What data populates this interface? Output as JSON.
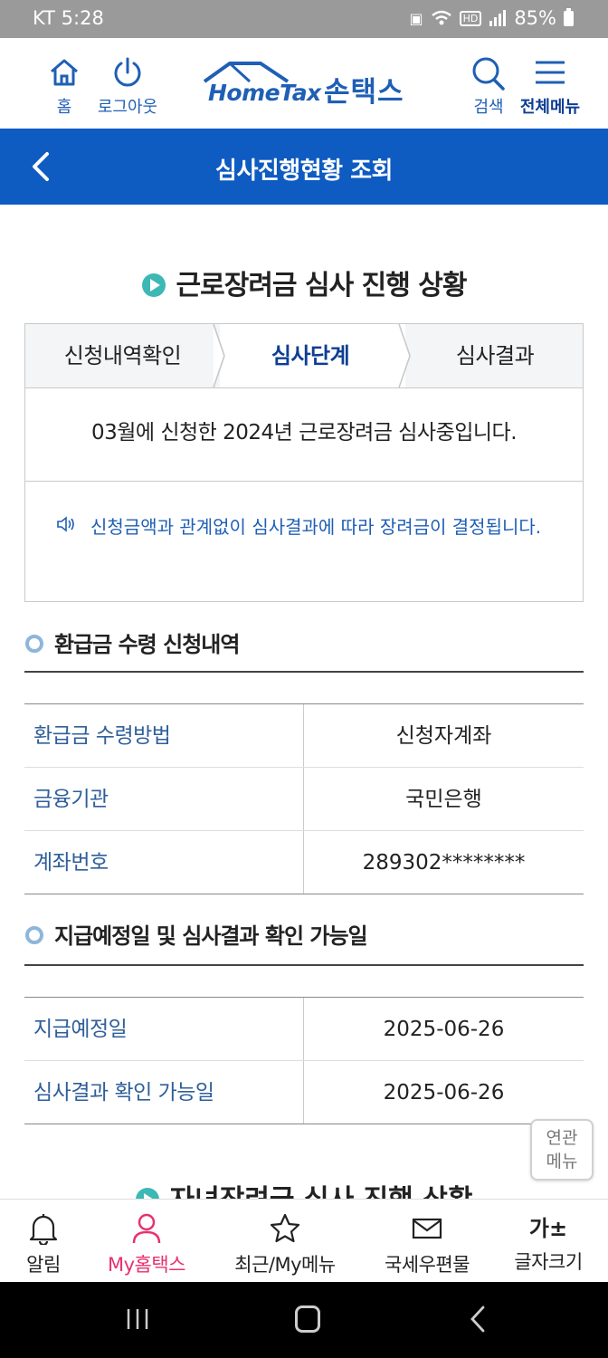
{
  "status_bar": {
    "carrier_time": "KT 5:28",
    "battery": "85%",
    "hd": "HD"
  },
  "header": {
    "home_label": "홈",
    "logout_label": "로그아웃",
    "logo_en": "HomeTax",
    "logo_ko": "손택스",
    "search_label": "검색",
    "menu_label": "전체메뉴"
  },
  "titlebar": {
    "title": "심사진행현황 조회"
  },
  "main": {
    "section_title": "근로장려금 심사 진행 상황",
    "steps": [
      "신청내역확인",
      "심사단계",
      "심사결과"
    ],
    "active_step": 1,
    "status_message": "03월에 신청한 2024년 근로장려금 심사중입니다.",
    "notice": "신청금액과 관계없이 심사결과에 따라 장려금이 결정됩니다."
  },
  "refund_section": {
    "title": "환급금 수령 신청내역",
    "rows": [
      {
        "label": "환급금 수령방법",
        "value": "신청자계좌"
      },
      {
        "label": "금융기관",
        "value": "국민은행"
      },
      {
        "label": "계좌번호",
        "value": "289302********"
      }
    ]
  },
  "payment_section": {
    "title": "지급예정일 및 심사결과 확인 가능일",
    "rows": [
      {
        "label": "지급예정일",
        "value": "2025-06-26"
      },
      {
        "label": "심사결과 확인 가능일",
        "value": "2025-06-26"
      }
    ]
  },
  "next_section_title": "자녀장려금 심사 진행 상황",
  "related_menu": {
    "line1": "연관",
    "line2": "메뉴"
  },
  "bottom_nav": [
    {
      "label": "알림",
      "icon": "bell-icon"
    },
    {
      "label": "My홈택스",
      "icon": "person-icon"
    },
    {
      "label": "최근/My메뉴",
      "icon": "star-icon"
    },
    {
      "label": "국세우편물",
      "icon": "mail-icon"
    },
    {
      "label": "글자크기",
      "icon": "font-size-icon"
    }
  ],
  "font_size_glyph": "가±",
  "colors": {
    "primary": "#0e5bc2",
    "accent_active": "#e8326c",
    "teal": "#3db8b5"
  }
}
